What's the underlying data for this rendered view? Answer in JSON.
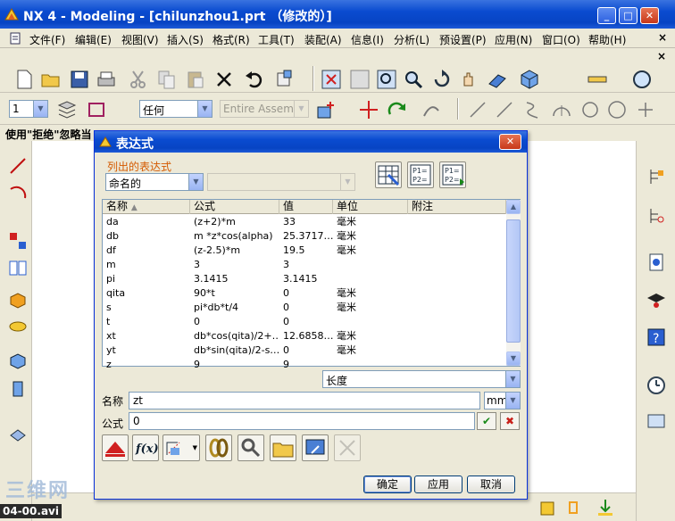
{
  "window": {
    "title": "NX 4 - Modeling - [chilunzhou1.prt （修改的）]",
    "minimize": "_",
    "maximize": "□",
    "close": "✕"
  },
  "menu": [
    "文件(F)",
    "编辑(E)",
    "视图(V)",
    "插入(S)",
    "格式(R)",
    "工具(T)",
    "装配(A)",
    "信息(I)",
    "分析(L)",
    "预设置(P)",
    "应用(N)",
    "窗口(O)",
    "帮助(H)"
  ],
  "toolbar2": {
    "layer_value": "1",
    "filter_value": "任何",
    "scope_value": "Entire Assembly"
  },
  "status": "使用\"拒绝\"忽略当",
  "dialog": {
    "title": "表达式",
    "close": "✕",
    "listed_label": "列出的表达式",
    "listed_value": "命名的",
    "columns": [
      "名称",
      "公式",
      "值",
      "单位",
      "附注"
    ],
    "rows": [
      {
        "name": "da",
        "formula": "(z+2)*m",
        "value": "33",
        "unit": "毫米"
      },
      {
        "name": "db",
        "formula": "m *z*cos(alpha)",
        "value": "25.3717…",
        "unit": "毫米"
      },
      {
        "name": "df",
        "formula": "(z-2.5)*m",
        "value": "19.5",
        "unit": "毫米"
      },
      {
        "name": "m",
        "formula": "3",
        "value": "3",
        "unit": ""
      },
      {
        "name": "pi",
        "formula": "3.1415",
        "value": "3.1415",
        "unit": ""
      },
      {
        "name": "qita",
        "formula": "90*t",
        "value": "0",
        "unit": "毫米"
      },
      {
        "name": "s",
        "formula": "pi*db*t/4",
        "value": "0",
        "unit": "毫米"
      },
      {
        "name": "t",
        "formula": "0",
        "value": "0",
        "unit": ""
      },
      {
        "name": "xt",
        "formula": "db*cos(qita)/2+…",
        "value": "12.6858…",
        "unit": "毫米"
      },
      {
        "name": "yt",
        "formula": "db*sin(qita)/2-s…",
        "value": "0",
        "unit": "毫米"
      },
      {
        "name": "z",
        "formula": "9",
        "value": "9",
        "unit": ""
      }
    ],
    "dimension_value": "长度",
    "name_label": "名称",
    "name_value": "zt",
    "unit_value": "mm",
    "formula_label": "公式",
    "formula_value": "0",
    "ok": "确定",
    "apply": "应用",
    "cancel": "取消"
  },
  "video_label": "04-00.avi",
  "watermark": "三维网",
  "colors": {
    "titlebar": "#0a4bd0",
    "group_label": "#d45a00",
    "check_green": "#1a8a1a",
    "x_red": "#c8201a"
  }
}
